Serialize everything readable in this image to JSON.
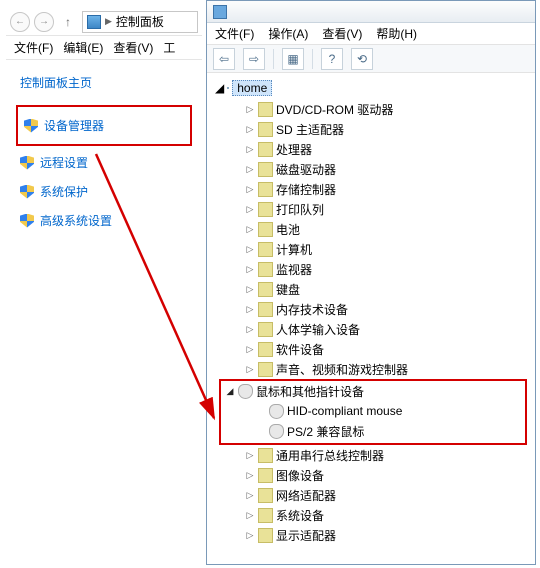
{
  "cp": {
    "address_label": "控制面板",
    "menu": {
      "file": "文件(F)",
      "edit": "编辑(E)",
      "view": "查看(V)",
      "tools": "工"
    },
    "home_link": "控制面板主页",
    "items": [
      {
        "label": "设备管理器"
      },
      {
        "label": "远程设置"
      },
      {
        "label": "系统保护"
      },
      {
        "label": "高级系统设置"
      }
    ]
  },
  "dm": {
    "menu": {
      "file": "文件(F)",
      "action": "操作(A)",
      "view": "查看(V)",
      "help": "帮助(H)"
    },
    "root": "home",
    "categories": [
      {
        "label": "DVD/CD-ROM 驱动器"
      },
      {
        "label": "SD 主适配器"
      },
      {
        "label": "处理器"
      },
      {
        "label": "磁盘驱动器"
      },
      {
        "label": "存储控制器"
      },
      {
        "label": "打印队列"
      },
      {
        "label": "电池"
      },
      {
        "label": "计算机"
      },
      {
        "label": "监视器"
      },
      {
        "label": "键盘"
      },
      {
        "label": "内存技术设备"
      },
      {
        "label": "人体学输入设备"
      },
      {
        "label": "软件设备"
      },
      {
        "label": "声音、视频和游戏控制器"
      }
    ],
    "mouse_category": "鼠标和其他指针设备",
    "mouse_children": [
      {
        "label": "HID-compliant mouse"
      },
      {
        "label": "PS/2 兼容鼠标"
      }
    ],
    "categories_after": [
      {
        "label": "通用串行总线控制器"
      },
      {
        "label": "图像设备"
      },
      {
        "label": "网络适配器"
      },
      {
        "label": "系统设备"
      },
      {
        "label": "显示适配器"
      }
    ]
  }
}
